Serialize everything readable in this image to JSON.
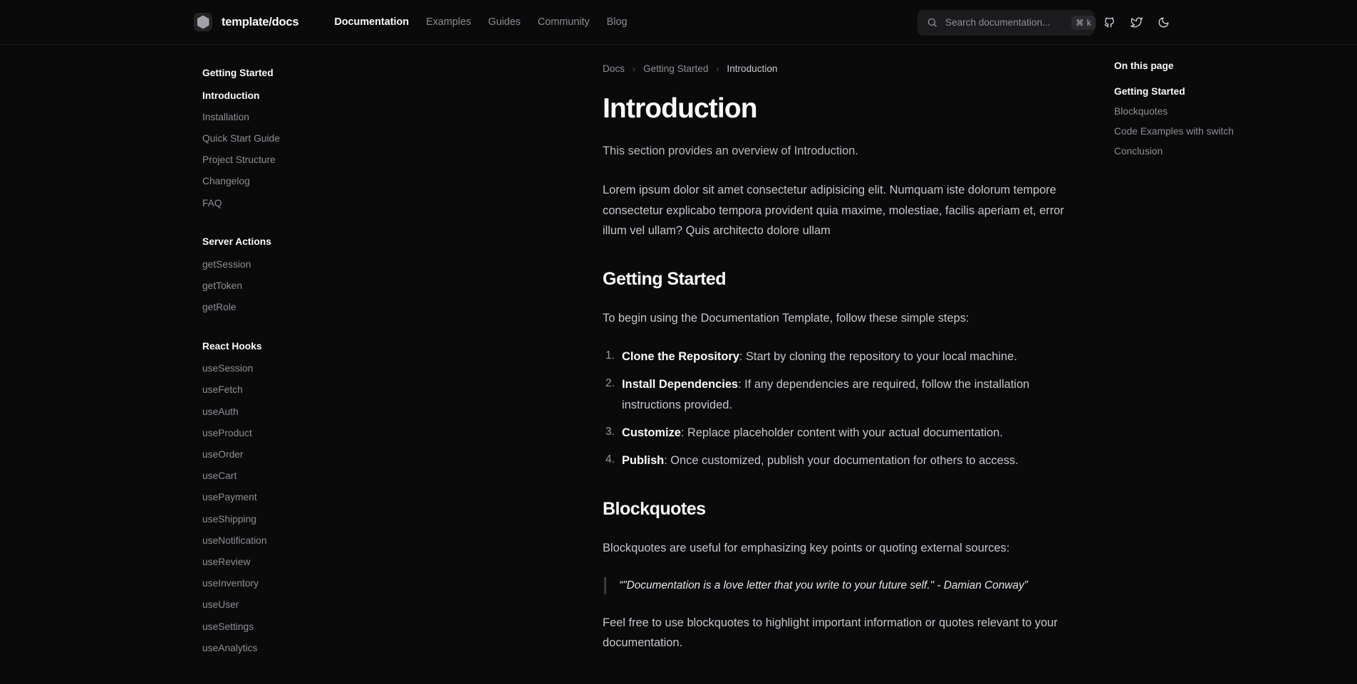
{
  "header": {
    "brand": "template/docs",
    "logo_icon": "hexagon-logo-icon",
    "nav": [
      {
        "label": "Documentation",
        "active": true
      },
      {
        "label": "Examples",
        "active": false
      },
      {
        "label": "Guides",
        "active": false
      },
      {
        "label": "Community",
        "active": false
      },
      {
        "label": "Blog",
        "active": false
      }
    ],
    "search": {
      "placeholder": "Search documentation...",
      "value": "",
      "shortcut": "⌘ k",
      "icon": "search-icon"
    },
    "icons": [
      {
        "name": "github-icon"
      },
      {
        "name": "twitter-icon"
      },
      {
        "name": "moon-theme-toggle-icon"
      }
    ]
  },
  "sidebar": {
    "sections": [
      {
        "title": "Getting Started",
        "items": [
          {
            "label": "Introduction",
            "active": true
          },
          {
            "label": "Installation",
            "active": false
          },
          {
            "label": "Quick Start Guide",
            "active": false
          },
          {
            "label": "Project Structure",
            "active": false
          },
          {
            "label": "Changelog",
            "active": false
          },
          {
            "label": "FAQ",
            "active": false
          }
        ]
      },
      {
        "title": "Server Actions",
        "items": [
          {
            "label": "getSession",
            "active": false
          },
          {
            "label": "getToken",
            "active": false
          },
          {
            "label": "getRole",
            "active": false
          }
        ]
      },
      {
        "title": "React Hooks",
        "items": [
          {
            "label": "useSession",
            "active": false
          },
          {
            "label": "useFetch",
            "active": false
          },
          {
            "label": "useAuth",
            "active": false
          },
          {
            "label": "useProduct",
            "active": false
          },
          {
            "label": "useOrder",
            "active": false
          },
          {
            "label": "useCart",
            "active": false
          },
          {
            "label": "usePayment",
            "active": false
          },
          {
            "label": "useShipping",
            "active": false
          },
          {
            "label": "useNotification",
            "active": false
          },
          {
            "label": "useReview",
            "active": false
          },
          {
            "label": "useInventory",
            "active": false
          },
          {
            "label": "useUser",
            "active": false
          },
          {
            "label": "useSettings",
            "active": false
          },
          {
            "label": "useAnalytics",
            "active": false
          }
        ]
      }
    ]
  },
  "breadcrumb": {
    "items": [
      "Docs",
      "Getting Started",
      "Introduction"
    ],
    "separator": "›"
  },
  "main": {
    "title": "Introduction",
    "lede": "This section provides an overview of Introduction.",
    "intro_paragraph": "Lorem ipsum dolor sit amet consectetur adipisicing elit. Numquam iste dolorum tempore consectetur explicabo tempora provident quia maxime, molestiae, facilis aperiam et, error illum vel ullam? Quis architecto dolore ullam",
    "getting_started": {
      "heading": "Getting Started",
      "intro": "To begin using the Documentation Template, follow these simple steps:",
      "steps": [
        {
          "term": "Clone the Repository",
          "text": ": Start by cloning the repository to your local machine."
        },
        {
          "term": "Install Dependencies",
          "text": ": If any dependencies are required, follow the installation instructions provided."
        },
        {
          "term": "Customize",
          "text": ": Replace placeholder content with your actual documentation."
        },
        {
          "term": "Publish",
          "text": ": Once customized, publish your documentation for others to access."
        }
      ]
    },
    "blockquotes": {
      "heading": "Blockquotes",
      "intro": "Blockquotes are useful for emphasizing key points or quoting external sources:",
      "quote": "“\"Documentation is a love letter that you write to your future self.\" - Damian Conway”",
      "outro": "Feel free to use blockquotes to highlight important information or quotes relevant to your documentation."
    }
  },
  "toc": {
    "title": "On this page",
    "items": [
      {
        "label": "Getting Started",
        "active": true
      },
      {
        "label": "Blockquotes",
        "active": false
      },
      {
        "label": "Code Examples with switch",
        "active": false
      },
      {
        "label": "Conclusion",
        "active": false
      }
    ]
  },
  "colors": {
    "background": "#0a0a0a",
    "text_primary": "#fafafa",
    "text_muted": "#8e8e96",
    "search_bg": "#1c1c1f",
    "border": "#1d1d1f"
  }
}
